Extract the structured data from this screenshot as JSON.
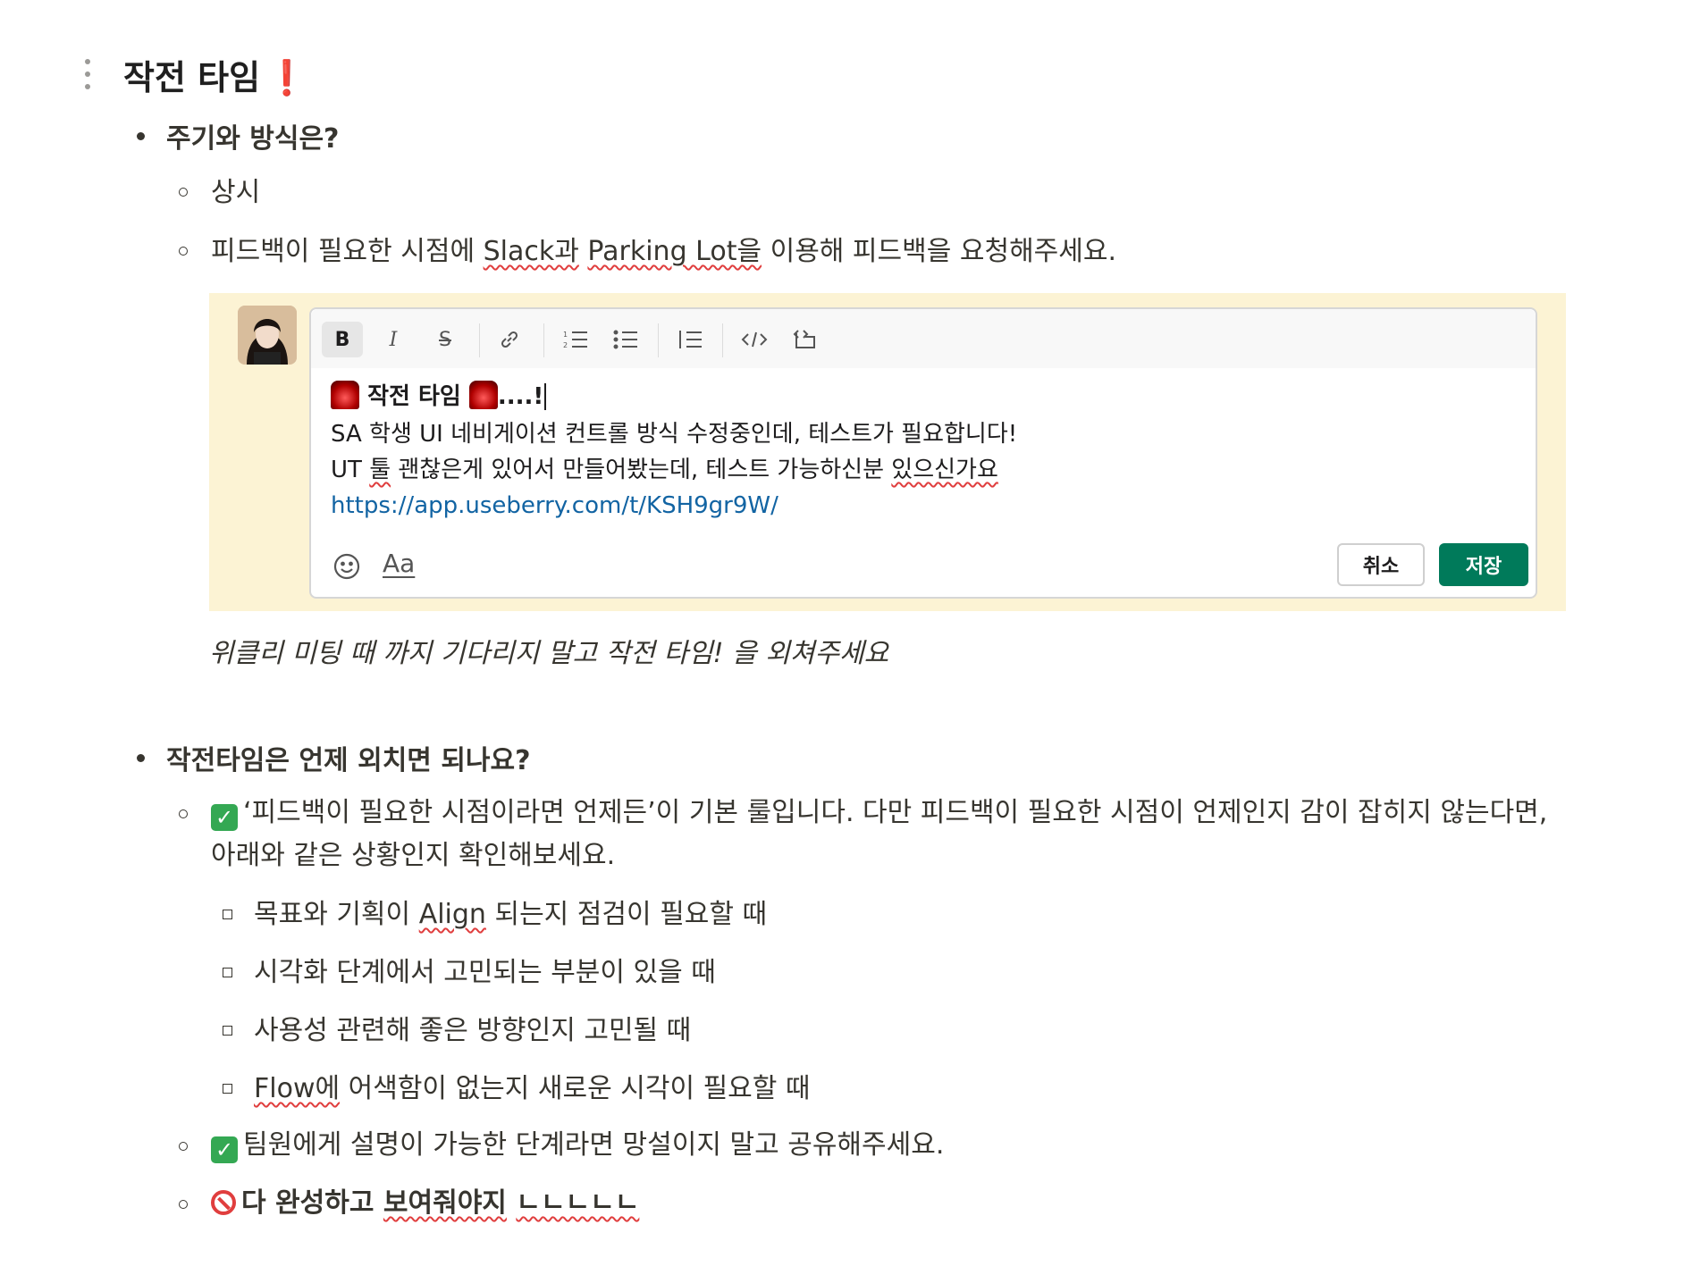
{
  "page": {
    "title": "작전 타임",
    "title_emoji": "❗"
  },
  "section1": {
    "heading": "주기와 방식은?",
    "items": [
      "상시",
      {
        "pre": "피드백이 필요한 시점에 ",
        "w1": "Slack과",
        "mid": " ",
        "w2": "Parking Lot을",
        "post": " 이용해 피드백을 요청해주세요."
      }
    ]
  },
  "slack_editor": {
    "toolbar": [
      "B",
      "I",
      "S",
      "link",
      "ordered-list",
      "bullet-list",
      "blockquote",
      "code",
      "code-block"
    ],
    "message_title": "작전 타임",
    "message_title_suffix": "....!",
    "line1": "SA 학생 UI 네비게이션 컨트롤 방식 수정중인데, 테스트가 필요합니다!",
    "line2_pre": "UT ",
    "line2_w1": "툴",
    "line2_mid": " 괜찮은게 있어서 만들어봤는데, 테스트 가능하신분 ",
    "line2_w2": "있으신가요",
    "link": "https://app.useberry.com/t/KSH9gr9W/",
    "format_label": "Aa",
    "cancel_label": "취소",
    "save_label": "저장"
  },
  "caption": "위클리 미팅 때 까지 기다리지 말고 작전 타임! 을 외쳐주세요",
  "section2": {
    "heading": "작전타임은 언제 외치면 되나요?",
    "item1_line1": "‘피드백이 필요한 시점이라면 언제든’이 기본 룰입니다. 다만 피드백이 필요한 시점이 언제인지 감이 잡히지 않는다면,",
    "item1_line2": "아래와 같은 상황인지 확인해보세요.",
    "sub": [
      {
        "pre": "목표와 기획이 ",
        "w": "Align",
        "post": " 되는지 점검이 필요할 때"
      },
      {
        "pre": "시각화 단계에서 고민되는 부분이 있을 때",
        "w": "",
        "post": ""
      },
      {
        "pre": "사용성 관련해 좋은 방향인지 고민될 때",
        "w": "",
        "post": ""
      },
      {
        "pre": "",
        "w": "Flow에",
        "post": " 어색함이 없는지 새로운 시각이 필요할 때"
      }
    ],
    "item2": "팀원에게 설명이 가능한 단계라면 망설이지 말고 공유해주세요.",
    "item3_pre": "다 완성하고 ",
    "item3_w1": "보여줘야지",
    "item3_mid": " ",
    "item3_w2": "ㄴㄴㄴㄴㄴ"
  },
  "colors": {
    "accent_green": "#007a5a",
    "link": "#1264a3",
    "highlight": "#fcf3d4",
    "error": "#e03e3e"
  }
}
